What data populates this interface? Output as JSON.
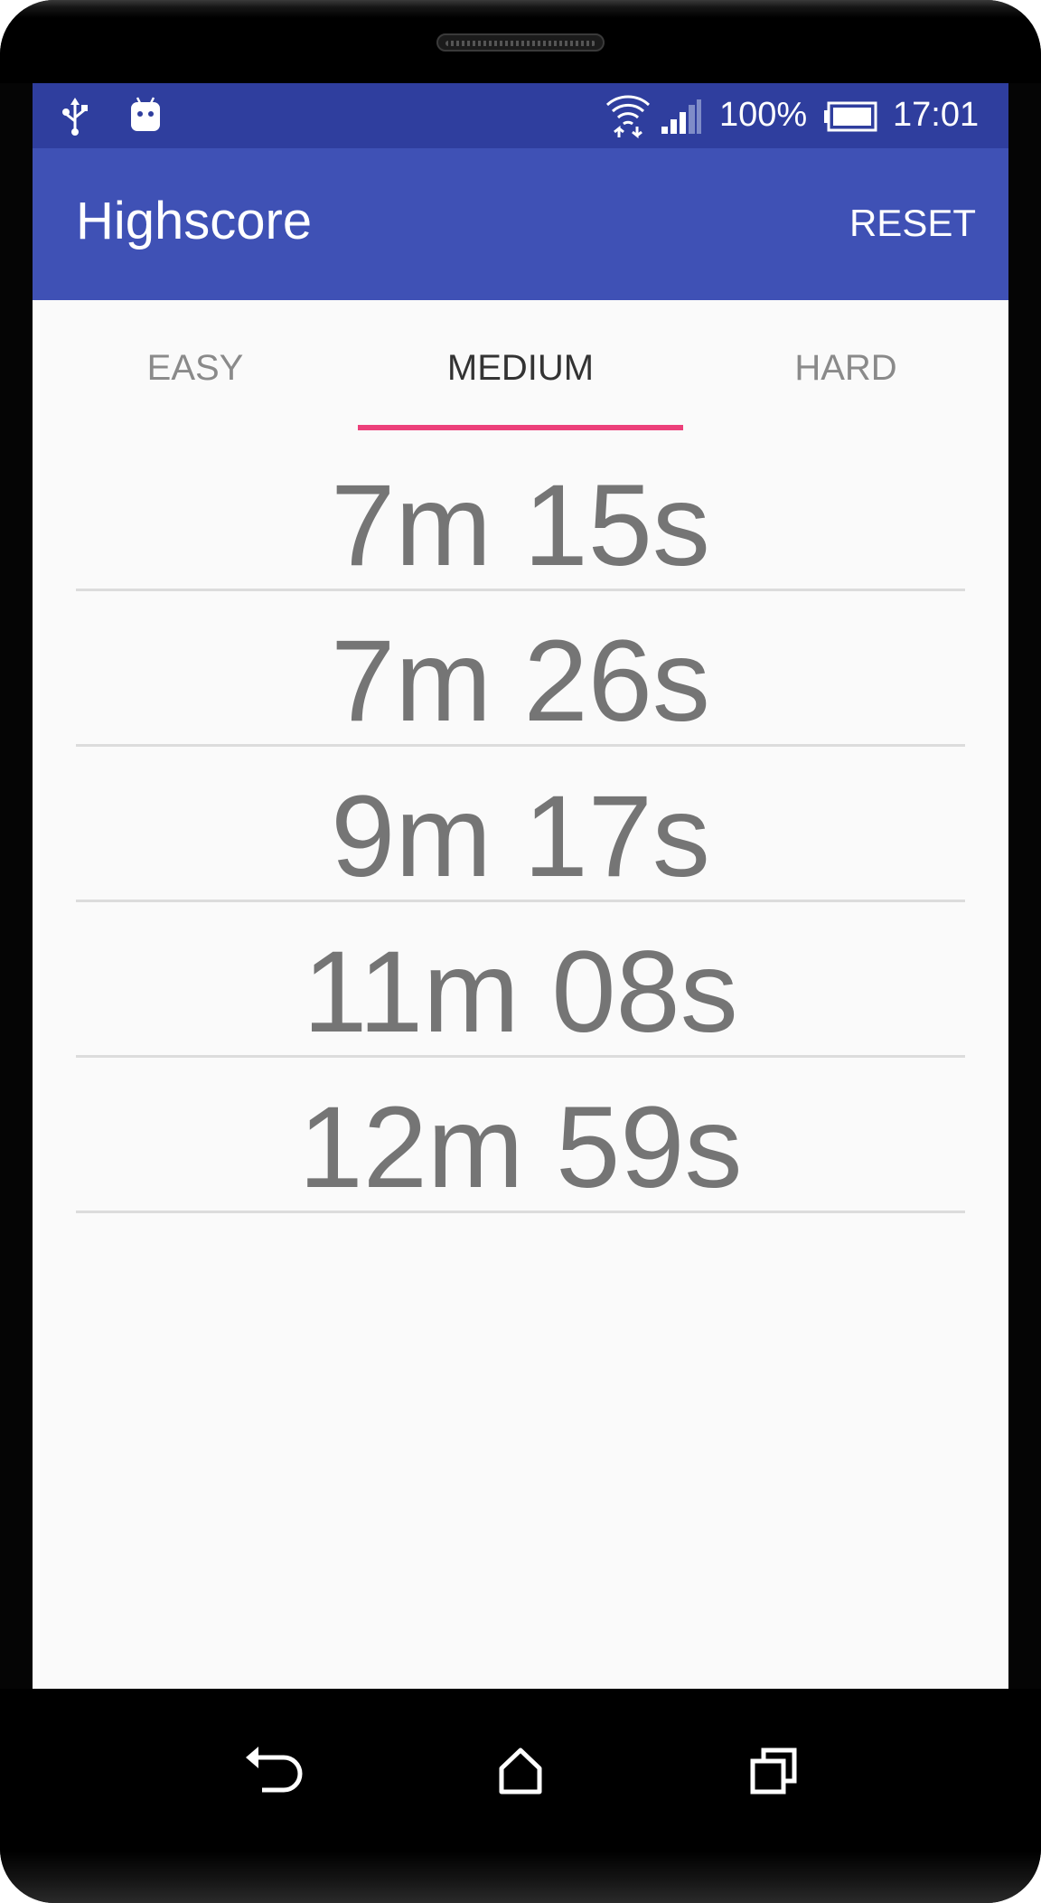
{
  "status_bar": {
    "battery_percent": "100%",
    "time": "17:01",
    "icons": [
      "usb-icon",
      "android-debug-icon",
      "wifi-icon",
      "signal-icon",
      "battery-icon"
    ]
  },
  "app_bar": {
    "title": "Highscore",
    "reset_label": "RESET"
  },
  "tabs": [
    {
      "label": "EASY",
      "active": false
    },
    {
      "label": "MEDIUM",
      "active": true
    },
    {
      "label": "HARD",
      "active": false
    }
  ],
  "scores": [
    "7m 15s",
    "7m 26s",
    "9m 17s",
    "11m 08s",
    "12m 59s"
  ],
  "colors": {
    "status_bar": "#2f3e9e",
    "app_bar": "#3f51b5",
    "tab_indicator": "#ec407a",
    "background": "#fafafa",
    "score_text": "#757575"
  },
  "nav_bar": {
    "icons": [
      "back-icon",
      "home-icon",
      "recents-icon"
    ]
  }
}
